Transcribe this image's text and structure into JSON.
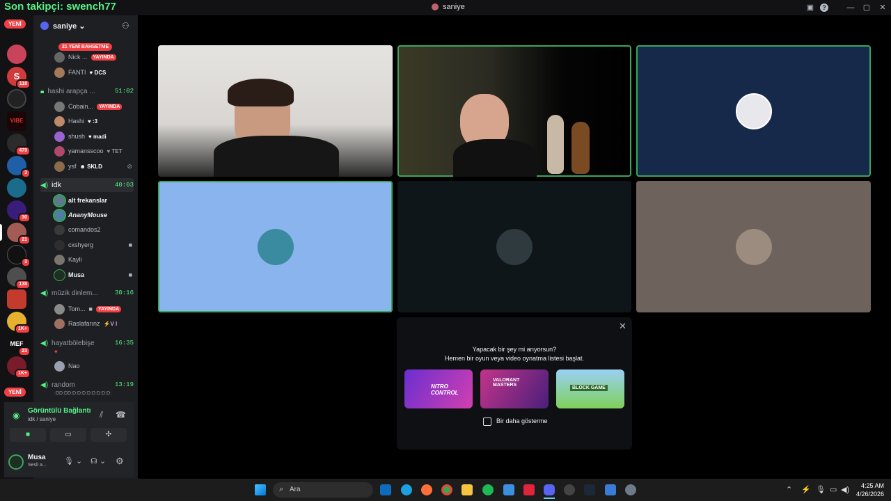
{
  "overlay": {
    "follower_text": "Son takipçi: swench77"
  },
  "window": {
    "title": "saniye"
  },
  "server_rail": {
    "new_top": "YENİ",
    "new_bottom": "YENİ",
    "badges": [
      "118",
      "479",
      "3",
      "30",
      "21",
      "3",
      "138",
      "1K+",
      "23",
      "1K+"
    ]
  },
  "guild": {
    "name": "saniye",
    "mentions_banner": "21 YENİ BAHSETME"
  },
  "channels": {
    "top_users": [
      {
        "name": "Nick ...",
        "status": "YAYINDA"
      },
      {
        "name": "FANTI",
        "tag": "DCS"
      }
    ],
    "hashi": {
      "name": "hashi arapça ...",
      "time": "51:02",
      "users": [
        {
          "name": "Cobain...",
          "status": "YAYINDA"
        },
        {
          "name": "Hashi",
          "tag": ":3"
        },
        {
          "name": "shush",
          "tag": "madi"
        },
        {
          "name": "yamansscoo",
          "tag": "TET"
        },
        {
          "name": "ysf",
          "tag": "SKLD"
        }
      ]
    },
    "idk": {
      "name": "idk",
      "time": "40:03",
      "users": [
        {
          "name": "alt frekanslar"
        },
        {
          "name": "AnanyMouse"
        },
        {
          "name": "comandos2"
        },
        {
          "name": "cxshyerg"
        },
        {
          "name": "Kayli"
        },
        {
          "name": "Musa"
        }
      ]
    },
    "muzik": {
      "name": "müzik dinlem...",
      "time": "30:16",
      "users": [
        {
          "name": "Tom...",
          "status": "YAYINDA"
        },
        {
          "name": "Raslafarınz",
          "tag": "V I"
        }
      ]
    },
    "hayat": {
      "name": "hayatbölebişe",
      "time": "16:35",
      "users": [
        {
          "name": "Nao"
        }
      ]
    },
    "random": {
      "name": "random",
      "time": "13:19",
      "sub": ":DD:DD:D:D:D:D:D:D:D:D:"
    }
  },
  "voice": {
    "status": "Görüntülü Bağlantı K",
    "location": "idk / saniye"
  },
  "user": {
    "name": "Musa",
    "status": "Sesli a..."
  },
  "activity_prompt": {
    "line1": "Yapacak bir şey mi arıyorsun?",
    "line2": "Hemen bir oyun veya video oynatma listesi başlat.",
    "checkbox": "Bir daha gösterme",
    "cards": [
      "NITRO CONTROL",
      "VALORANT MASTERS",
      "BLOCK GAME"
    ]
  },
  "taskbar": {
    "search": "Ara",
    "time": "4:25 AM",
    "date": "4/26/2026"
  },
  "colors": {
    "accent_green": "#3ba55c",
    "live_red": "#f23f43",
    "tile_blue": "#8ab4ee",
    "tile_navy": "#17294a",
    "tile_taupe": "#6e625c"
  }
}
